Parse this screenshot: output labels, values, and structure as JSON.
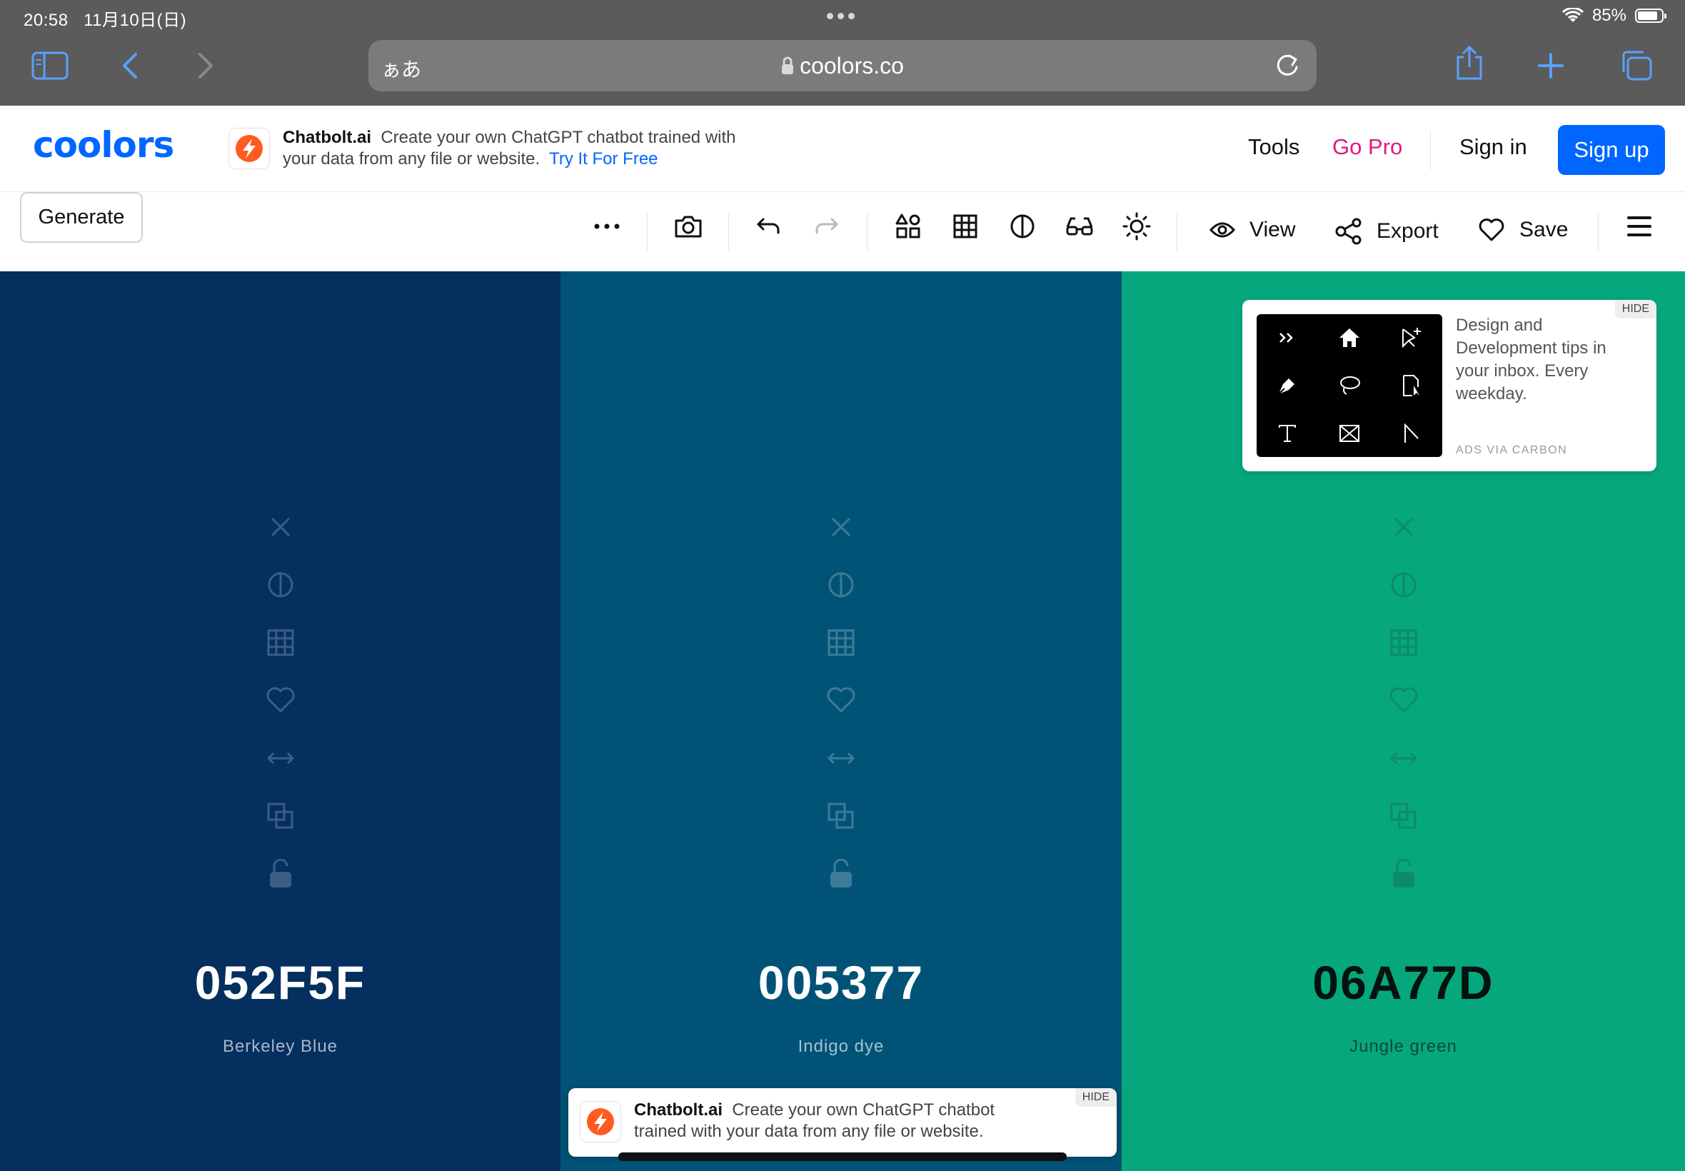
{
  "status_bar": {
    "time": "20:58",
    "date": "11月10日(日)",
    "wifi_icon": "wifi-icon",
    "battery": "85%"
  },
  "browser": {
    "aa_label": "ぁあ",
    "url": "coolors.co",
    "lock_icon": "lock-icon"
  },
  "header": {
    "logo": "coolors",
    "ad": {
      "brand": "Chatbolt.ai",
      "text": "Create your own ChatGPT chatbot trained with your data from any file or website.",
      "cta": "Try It For Free"
    },
    "nav": {
      "tools": "Tools",
      "go_pro": "Go Pro",
      "sign_in": "Sign in",
      "sign_up": "Sign up"
    }
  },
  "toolbar": {
    "generate": "Generate",
    "view": "View",
    "export": "Export",
    "save": "Save"
  },
  "palette": [
    {
      "hex": "052F5F",
      "name": "Berkeley Blue",
      "color": "#052F5F",
      "text_color": "#ffffff",
      "name_color": "#a8b7c9",
      "icon_color": "#3c5d84"
    },
    {
      "hex": "005377",
      "name": "Indigo dye",
      "color": "#005377",
      "text_color": "#ffffff",
      "name_color": "#a6c1cf",
      "icon_color": "#3d7b97"
    },
    {
      "hex": "06A77D",
      "name": "Jungle green",
      "color": "#06A77D",
      "text_color": "#05120e",
      "name_color": "#0a4a39",
      "icon_color": "#0f8a68"
    }
  ],
  "carbon_ad": {
    "text": "Design and Development tips in your inbox. Every weekday.",
    "via": "ADS VIA CARBON",
    "hide": "HIDE"
  },
  "bottom_ad": {
    "brand": "Chatbolt.ai",
    "text": "Create your own ChatGPT chatbot trained with your data from any file or website.",
    "hide": "HIDE"
  },
  "colors": {
    "brand_blue": "#0066ff",
    "go_pro_pink": "#e2187f"
  }
}
